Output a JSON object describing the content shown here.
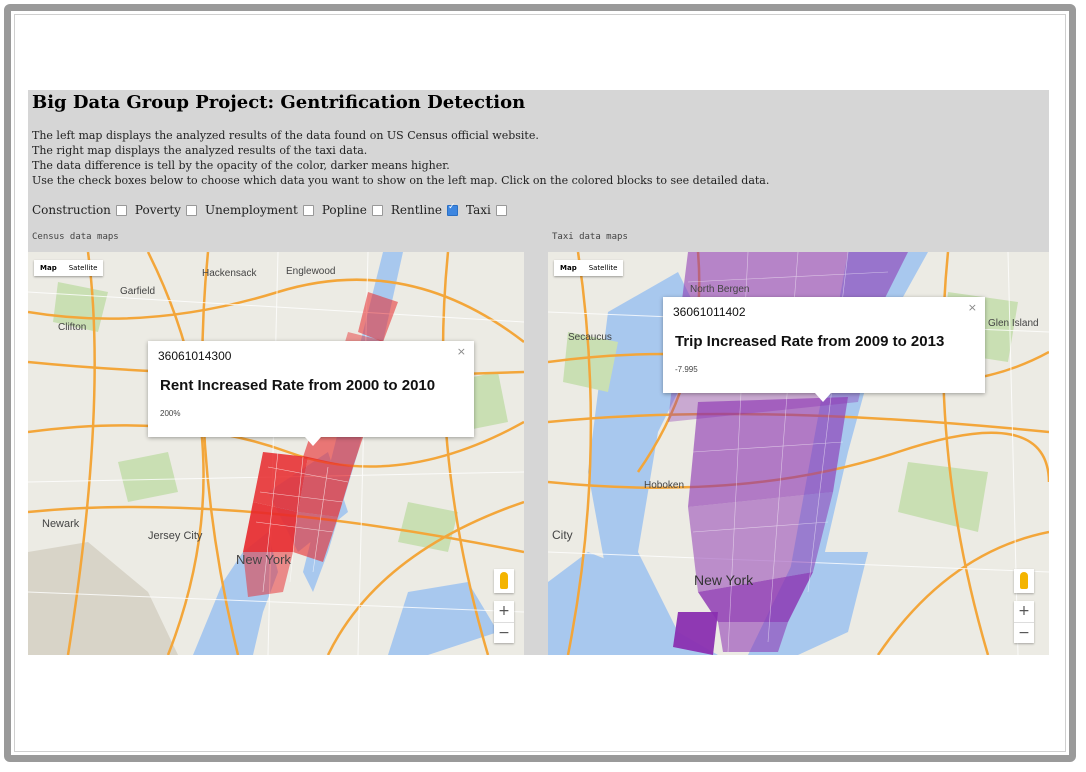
{
  "page": {
    "title": "Big Data Group Project: Gentrification Detection",
    "description": [
      "The left map displays the analyzed results of the data found on US Census official website.",
      "The right map displays the analyzed results of the taxi data.",
      "The data difference is tell by the opacity of the color, darker means higher.",
      "Use the check boxes below to choose which data you want to show on the left map. Click on the colored blocks to see detailed data."
    ]
  },
  "checkboxes": [
    {
      "label": "Construction",
      "checked": false
    },
    {
      "label": "Poverty",
      "checked": false
    },
    {
      "label": "Unemployment",
      "checked": false
    },
    {
      "label": "Popline",
      "checked": false
    },
    {
      "label": "Rentline",
      "checked": true
    },
    {
      "label": "Taxi",
      "checked": false
    }
  ],
  "left_map": {
    "label": "Census data maps",
    "map_type": {
      "map": "Map",
      "satellite": "Satellite"
    },
    "popup": {
      "tract_id": "36061014300",
      "heading": "Rent Increased Rate from 2000 to 2010",
      "value": "200%",
      "close": "×"
    },
    "city_label": "New York",
    "places": [
      "Hackensack",
      "Englewood",
      "Clifton",
      "Newark",
      "Jersey City",
      "Garfield"
    ],
    "overlay_color": "#e8282b"
  },
  "right_map": {
    "label": "Taxi data maps",
    "map_type": {
      "map": "Map",
      "satellite": "Satellite"
    },
    "popup": {
      "tract_id": "36061011402",
      "heading": "Trip Increased Rate from 2009 to 2013",
      "value": "-7.995",
      "close": "×"
    },
    "city_label": "New York",
    "places": [
      "North Bergen",
      "Secaucus",
      "Hoboken",
      "City",
      "Glen Island"
    ],
    "overlay_color": "#8a2fb0"
  },
  "controls": {
    "zoom_in": "+",
    "zoom_out": "−"
  },
  "colors": {
    "panel_bg": "#d6d6d6",
    "road": "#f3a63a",
    "water": "#a8c8ee",
    "park": "#c9dfb3"
  }
}
